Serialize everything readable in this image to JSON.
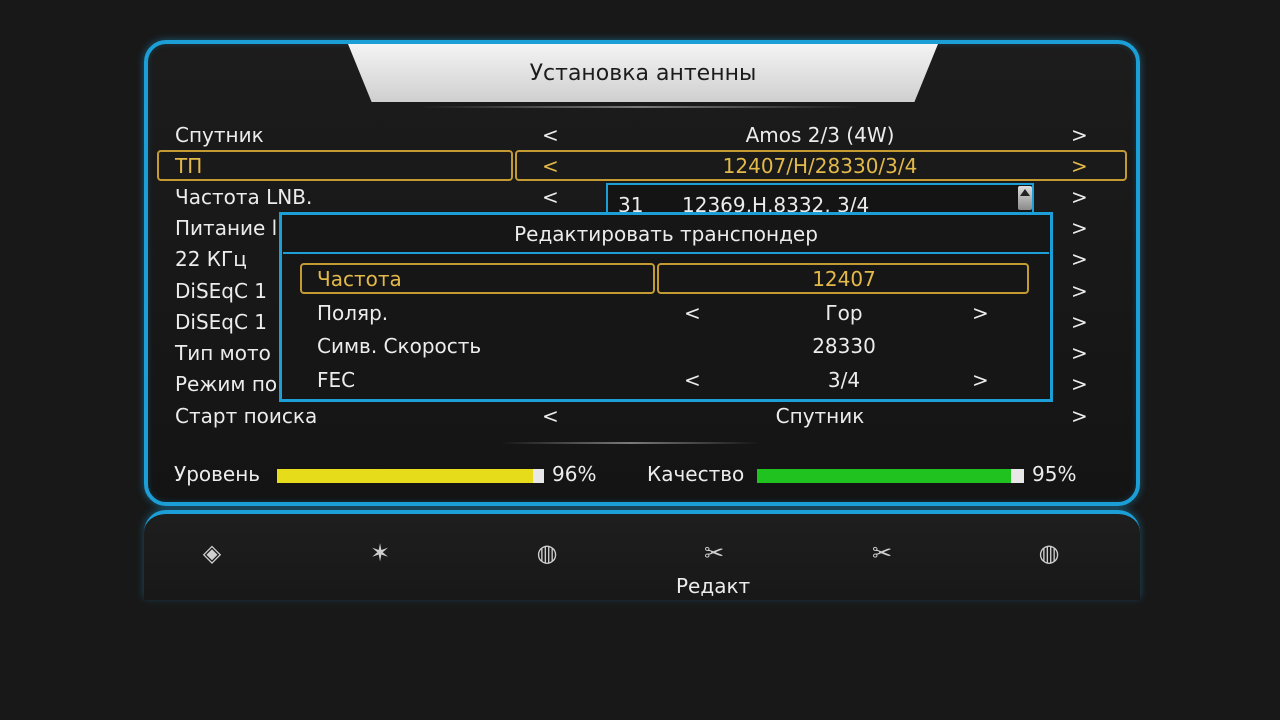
{
  "header": {
    "title": "Установка антенны"
  },
  "settings": {
    "rows": [
      {
        "label": "Спутник",
        "value": "Amos 2/3 (4W)"
      },
      {
        "label": "ТП",
        "value": "12407/H/28330/3/4"
      },
      {
        "label": "Частота LNB.",
        "value": ""
      },
      {
        "label": "Питание l",
        "value": ""
      },
      {
        "label": "22 КГц",
        "value": ""
      },
      {
        "label": "DiSEqC 1",
        "value": ""
      },
      {
        "label": "DiSEqC 1",
        "value": ""
      },
      {
        "label": "Тип мото",
        "value": ""
      },
      {
        "label": "Режим по",
        "value": ""
      },
      {
        "label": "Старт поиска",
        "value": "Спутник"
      }
    ],
    "arrow_left": "<",
    "arrow_right": ">"
  },
  "tp_list": {
    "number": "31",
    "entry": "12369,H,8332, 3/4"
  },
  "dialog": {
    "title": "Редактировать транспондер",
    "rows": [
      {
        "label": "Частота",
        "value": "12407"
      },
      {
        "label": "Поляр.",
        "value": "Гор"
      },
      {
        "label": "Симв. Скорость",
        "value": "28330"
      },
      {
        "label": "FEC",
        "value": "3/4"
      }
    ]
  },
  "signal": {
    "level_label": "Уровень",
    "level_value": "96%",
    "level_fraction": 0.96,
    "quality_label": "Качество",
    "quality_value": "95%",
    "quality_fraction": 0.95,
    "level_color": "#e6dc1a",
    "quality_color": "#1fc21f"
  },
  "toolbar": {
    "icons": [
      {
        "name": "dish-icon",
        "glyph": "◈"
      },
      {
        "name": "satellite-icon",
        "glyph": "✶"
      },
      {
        "name": "globe-icon",
        "glyph": "◍"
      },
      {
        "name": "edit-tools-icon",
        "glyph": "✂"
      },
      {
        "name": "tools-icon",
        "glyph": "✂"
      },
      {
        "name": "globe-search-icon",
        "glyph": "◍"
      }
    ],
    "active_label": "Редакт"
  }
}
